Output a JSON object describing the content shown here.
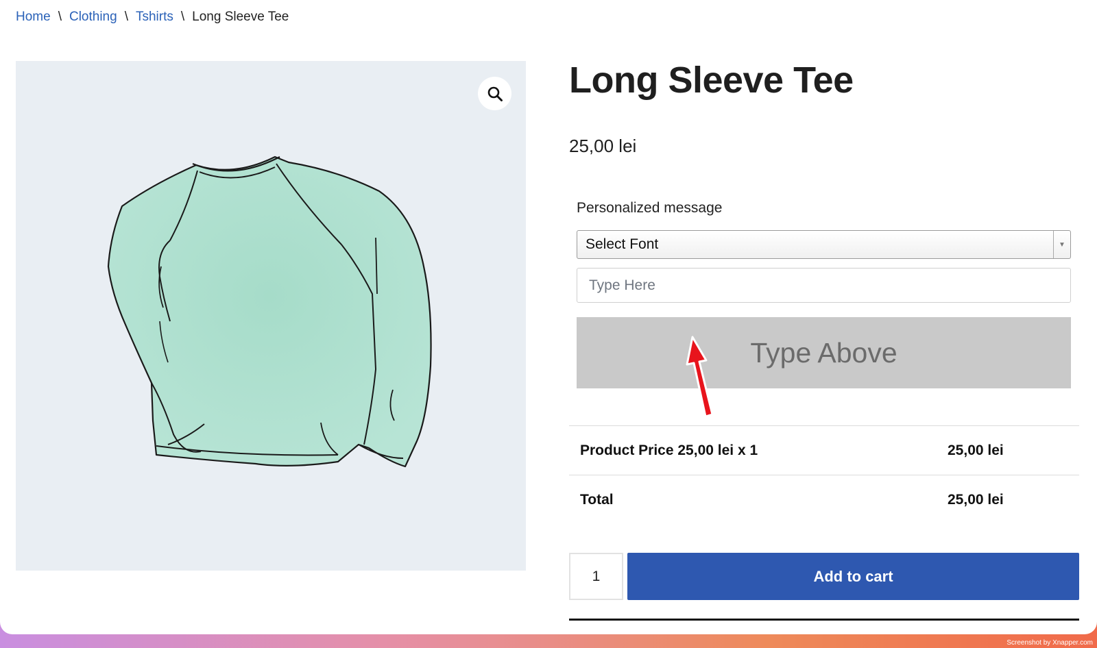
{
  "breadcrumb": {
    "items": [
      {
        "label": "Home"
      },
      {
        "label": "Clothing"
      },
      {
        "label": "Tshirts"
      }
    ],
    "current": "Long Sleeve Tee",
    "separator": "\\"
  },
  "product": {
    "title": "Long Sleeve Tee",
    "price": "25,00 lei",
    "image_icon": "long-sleeve-tshirt-illustration"
  },
  "personalization": {
    "label": "Personalized message",
    "font_select_value": "Select Font",
    "text_placeholder": "Type Here",
    "preview_text": "Type Above"
  },
  "totals": {
    "rows": [
      {
        "label": "Product Price 25,00 lei x 1",
        "value": "25,00 lei"
      },
      {
        "label": "Total",
        "value": "25,00 lei"
      }
    ]
  },
  "cart": {
    "quantity": "1",
    "add_label": "Add to cart"
  },
  "watermark": "Screenshot by Xnapper.com",
  "colors": {
    "link": "#2b62b8",
    "button": "#2e58b0",
    "preview_bg": "#c9c9c9",
    "annotation_arrow": "#e8141c"
  }
}
